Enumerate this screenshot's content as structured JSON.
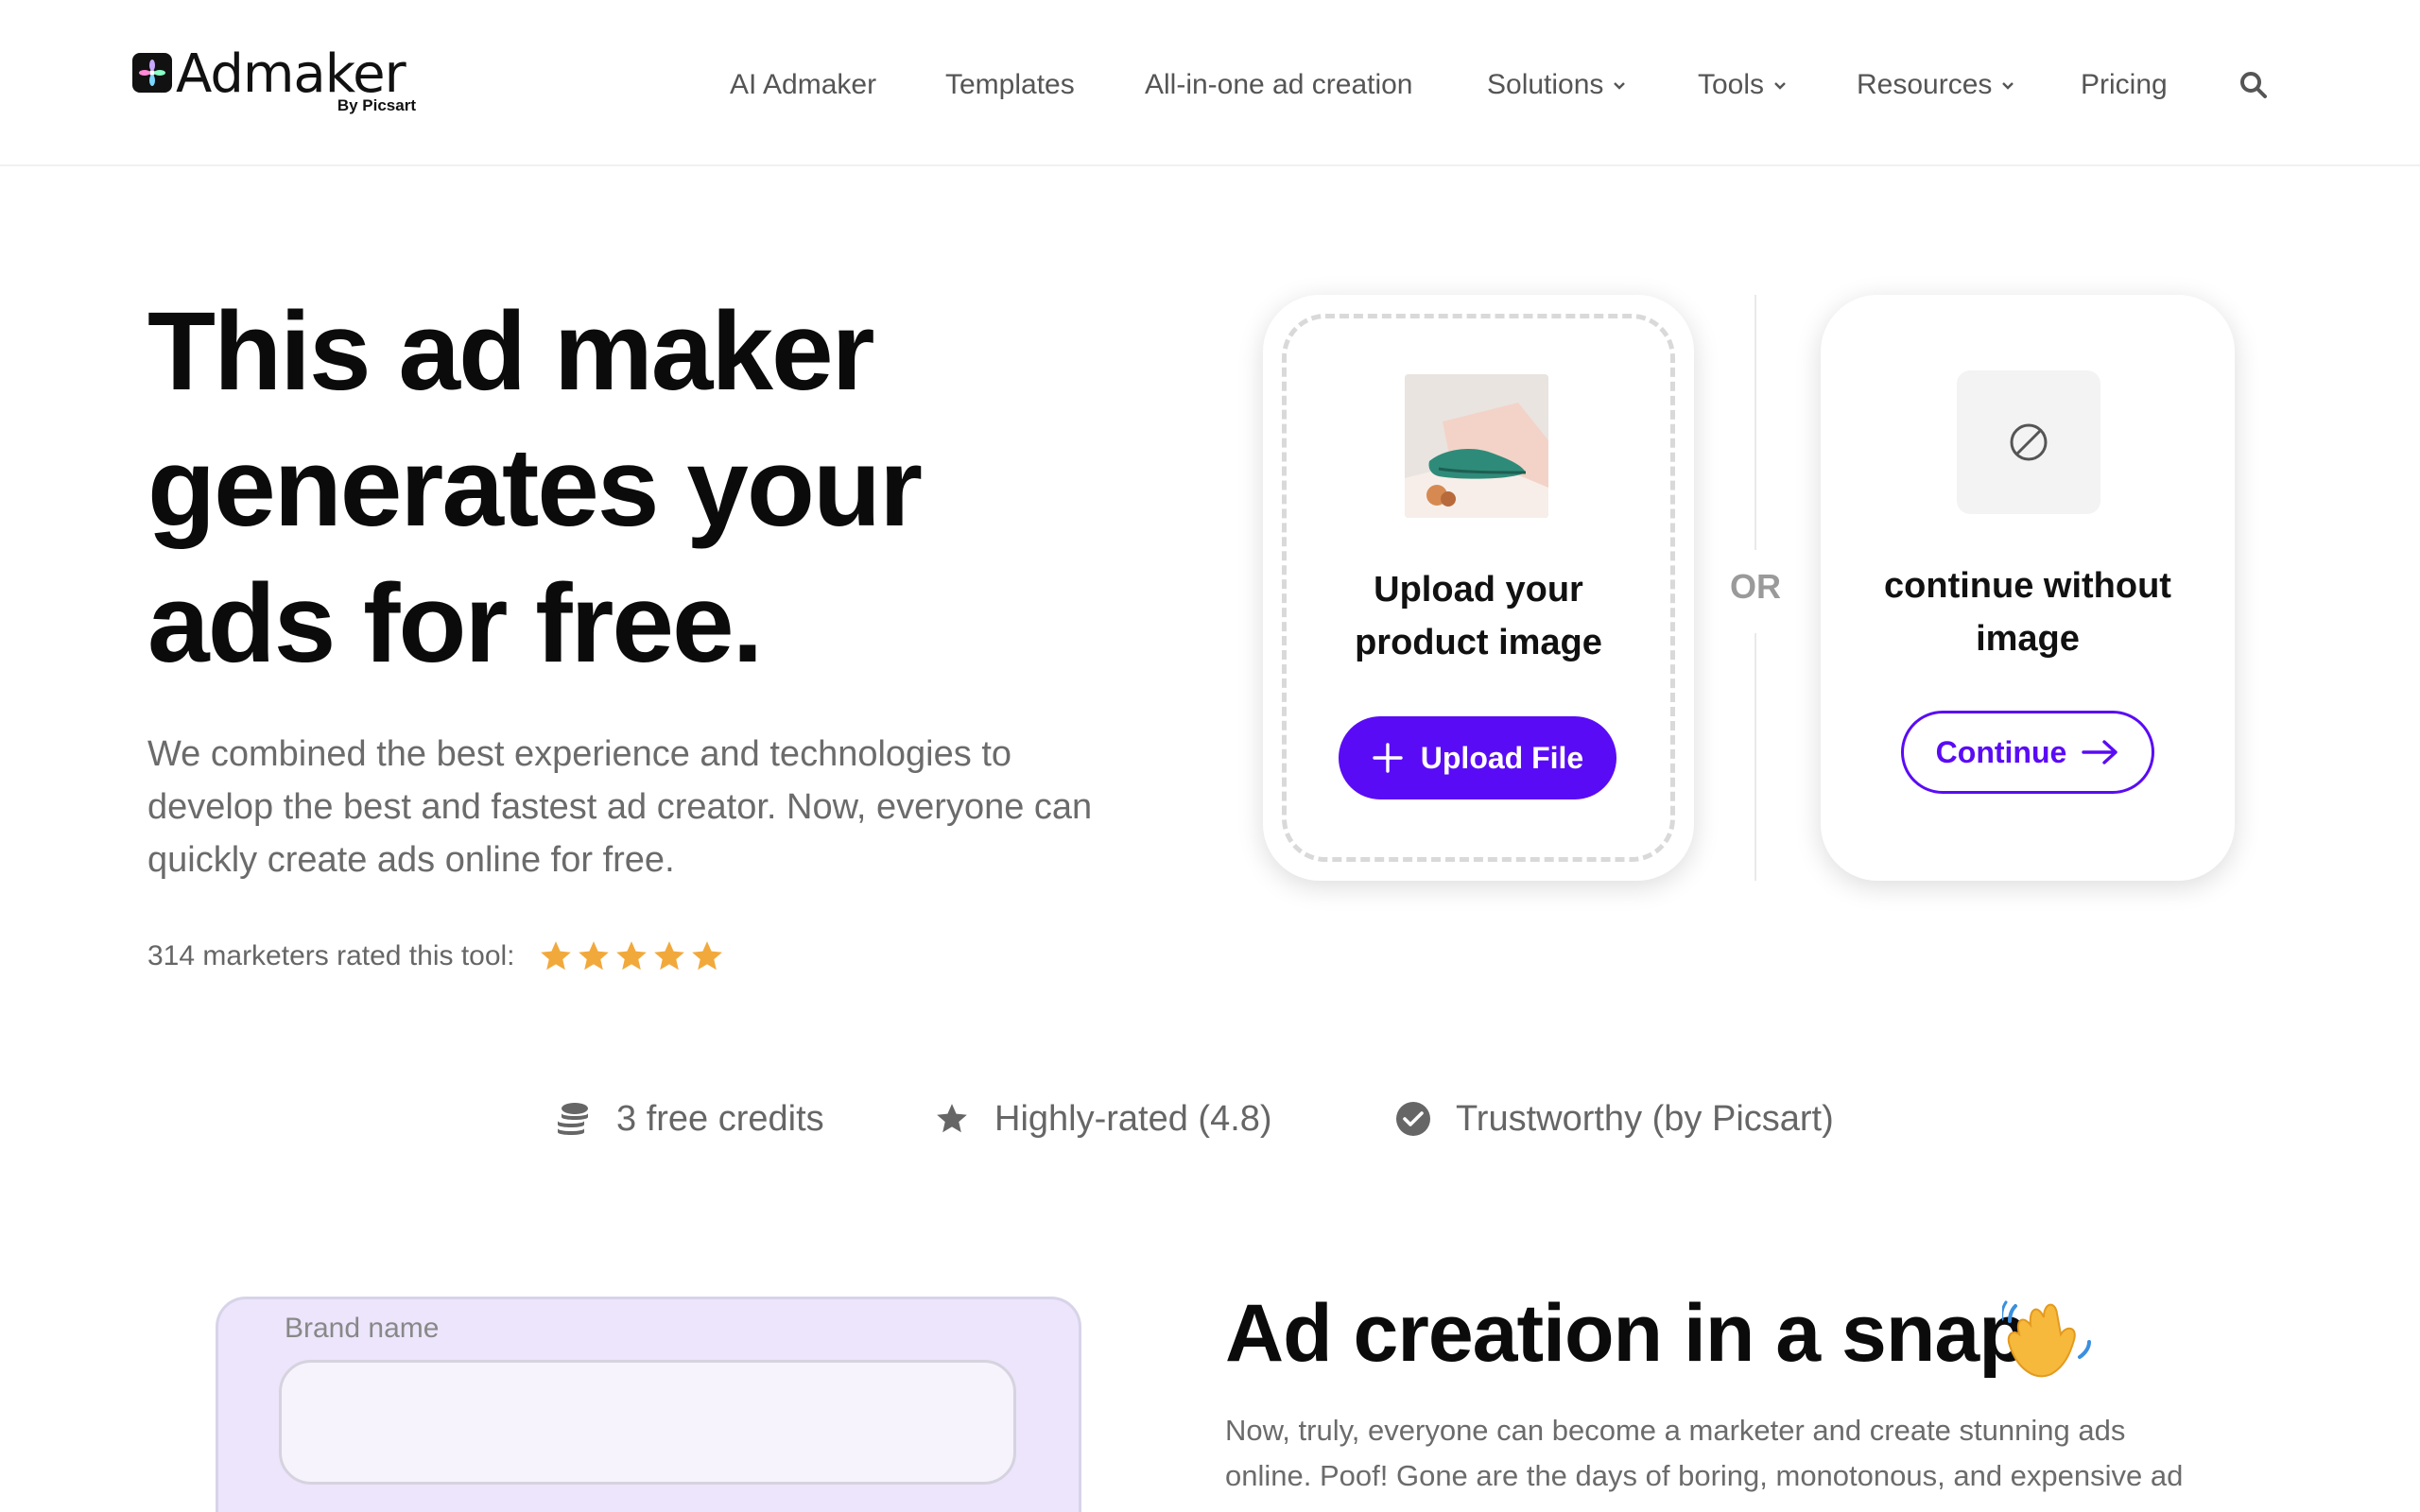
{
  "brand": {
    "name": "Admaker",
    "sub": "By Picsart"
  },
  "nav": {
    "items": [
      {
        "label": "AI Admaker"
      },
      {
        "label": "Templates"
      },
      {
        "label": "All-in-one ad creation"
      },
      {
        "label": "Solutions"
      },
      {
        "label": "Tools"
      },
      {
        "label": "Resources"
      },
      {
        "label": "Pricing"
      }
    ],
    "search_icon": "search-icon"
  },
  "hero": {
    "title_lines": [
      "This ad maker",
      "generates your",
      "ads for free."
    ],
    "description_lines": [
      "We combined the best experience and technologies to",
      "develop the best and fastest ad creator. Now, everyone can",
      "quickly create ads online for free."
    ],
    "rating_text": "314 marketers rated this tool:",
    "rating_stars": 5
  },
  "upload_card": {
    "label_lines": [
      "Upload your",
      "product image"
    ],
    "button_label": "Upload File",
    "button_icon": "plus-icon"
  },
  "divider": {
    "or_label": "OR"
  },
  "continue_card": {
    "label_lines": [
      "continue without",
      "image"
    ],
    "button_label": "Continue",
    "button_icon": "arrow-right-icon",
    "placeholder_icon": "no-image-icon"
  },
  "features": [
    {
      "label": "3 free credits",
      "icon": "coins-icon"
    },
    {
      "label": "Highly-rated (4.8)",
      "icon": "star-icon"
    },
    {
      "label": "Trustworthy (by Picsart)",
      "icon": "check-circle-icon"
    }
  ],
  "form": {
    "brand_label": "Brand name",
    "brand_value": ""
  },
  "section": {
    "title": "Ad creation in a snap",
    "emoji_icon": "waving-hand-icon",
    "description_lines": [
      "Now, truly, everyone can become a marketer and create stunning ads",
      "online. Poof! Gone are the days of boring, monotonous, and expensive ad"
    ]
  },
  "colors": {
    "accent": "#5a0bf5",
    "star": "#f2a93b",
    "text_muted": "#6b6b6b",
    "panel": "#ece5fb"
  }
}
